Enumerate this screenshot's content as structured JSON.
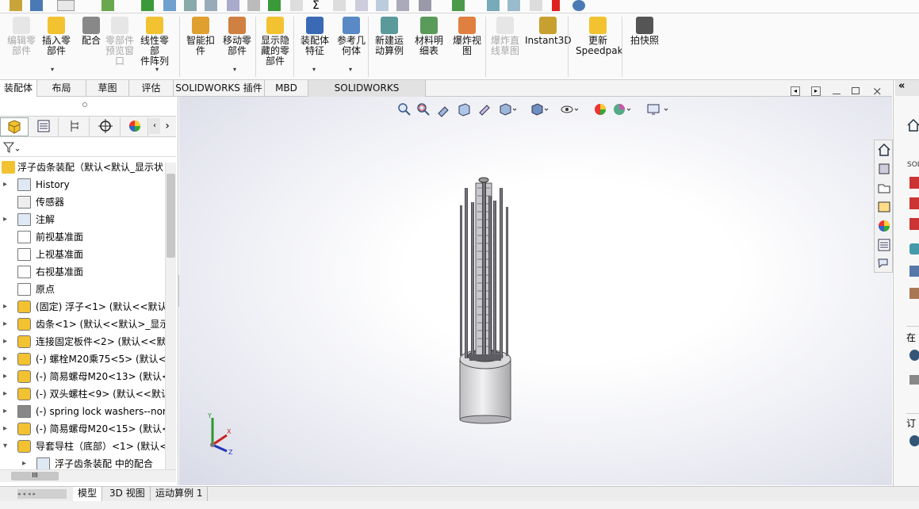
{
  "commands": [
    {
      "key": "edit_component",
      "label_line1": "编辑零",
      "label_line2": "部件",
      "disabled": true
    },
    {
      "key": "insert_component",
      "label_line1": "插入零",
      "label_line2": "部件",
      "disabled": false
    },
    {
      "key": "mate",
      "label_line1": "配合",
      "label_line2": "",
      "disabled": false
    },
    {
      "key": "component_preview",
      "label_line1": "零部件",
      "label_line2": "预览窗",
      "label_line3": "口",
      "disabled": true
    },
    {
      "key": "linear_pattern",
      "label_line1": "线性零部",
      "label_line2": "件阵列",
      "disabled": false
    },
    {
      "key": "smart_fasteners",
      "label_line1": "智能扣",
      "label_line2": "件",
      "disabled": false
    },
    {
      "key": "move_component",
      "label_line1": "移动零",
      "label_line2": "部件",
      "disabled": false
    },
    {
      "key": "show_hidden",
      "label_line1": "显示隐",
      "label_line2": "藏的零",
      "label_line3": "部件",
      "disabled": false
    },
    {
      "key": "assembly_features",
      "label_line1": "装配体",
      "label_line2": "特征",
      "disabled": false
    },
    {
      "key": "reference_geometry",
      "label_line1": "参考几",
      "label_line2": "何体",
      "disabled": false
    },
    {
      "key": "new_motion_study",
      "label_line1": "新建运",
      "label_line2": "动算例",
      "disabled": false
    },
    {
      "key": "bill_of_materials",
      "label_line1": "材料明",
      "label_line2": "细表",
      "disabled": false
    },
    {
      "key": "exploded_view",
      "label_line1": "爆炸视",
      "label_line2": "图",
      "disabled": false
    },
    {
      "key": "explode_line_sketch",
      "label_line1": "爆炸直",
      "label_line2": "线草图",
      "disabled": true
    },
    {
      "key": "instant3d",
      "label_line1": "Instant3D",
      "label_line2": "",
      "disabled": false
    },
    {
      "key": "update_speedpak",
      "label_line1": "更新",
      "label_line2": "Speedpak",
      "disabled": false
    },
    {
      "key": "snapshot",
      "label_line1": "拍快照",
      "label_line2": "",
      "disabled": false
    }
  ],
  "tabs": [
    "装配体",
    "布局",
    "草图",
    "评估",
    "SOLIDWORKS 插件",
    "MBD",
    "SOLIDWORKS Inspection"
  ],
  "tree": {
    "root": "浮子齿条装配（默认<默认_显示状",
    "items": [
      {
        "label": "History",
        "icon": "history-icon",
        "expand": "▸"
      },
      {
        "label": "传感器",
        "icon": "sensor-icon",
        "expand": ""
      },
      {
        "label": "注解",
        "icon": "annotation-icon",
        "expand": "▸"
      },
      {
        "label": "前视基准面",
        "icon": "plane-icon",
        "expand": ""
      },
      {
        "label": "上视基准面",
        "icon": "plane-icon",
        "expand": ""
      },
      {
        "label": "右视基准面",
        "icon": "plane-icon",
        "expand": ""
      },
      {
        "label": "原点",
        "icon": "origin-icon",
        "expand": ""
      },
      {
        "label": "(固定) 浮子<1> (默认<<默认",
        "icon": "part-icon",
        "expand": "▸"
      },
      {
        "label": "齿条<1> (默认<<默认>_显示",
        "icon": "part-icon",
        "expand": "▸"
      },
      {
        "label": "连接固定板件<2> (默认<<默",
        "icon": "part-icon",
        "expand": "▸"
      },
      {
        "label": "(-) 螺栓M20乘75<5> (默认<",
        "icon": "part-icon",
        "expand": "▸"
      },
      {
        "label": "(-) 简易螺母M20<13> (默认<",
        "icon": "part-icon",
        "expand": "▸"
      },
      {
        "label": "(-) 双头螺柱<9> (默认<<默认",
        "icon": "part-icon",
        "expand": "▸"
      },
      {
        "label": "(-) spring lock washers--nor",
        "icon": "bolt-icon",
        "expand": "▸"
      },
      {
        "label": "(-) 简易螺母M20<15> (默认<",
        "icon": "part-icon",
        "expand": "▸"
      },
      {
        "label": "导套导柱（底部）<1> (默认<",
        "icon": "part-icon",
        "expand": "▾"
      },
      {
        "label": "浮子齿条装配 中的配合",
        "icon": "mate-icon",
        "expand": "▸",
        "indent": true
      }
    ]
  },
  "bottom_tabs": [
    "模型",
    "3D 视图",
    "运动算例 1"
  ],
  "right_pane": {
    "label_top": "SOL",
    "label_zai": "在",
    "label_ding": "订"
  },
  "triad": {
    "x": "X",
    "y": "Y",
    "z": "Z"
  }
}
